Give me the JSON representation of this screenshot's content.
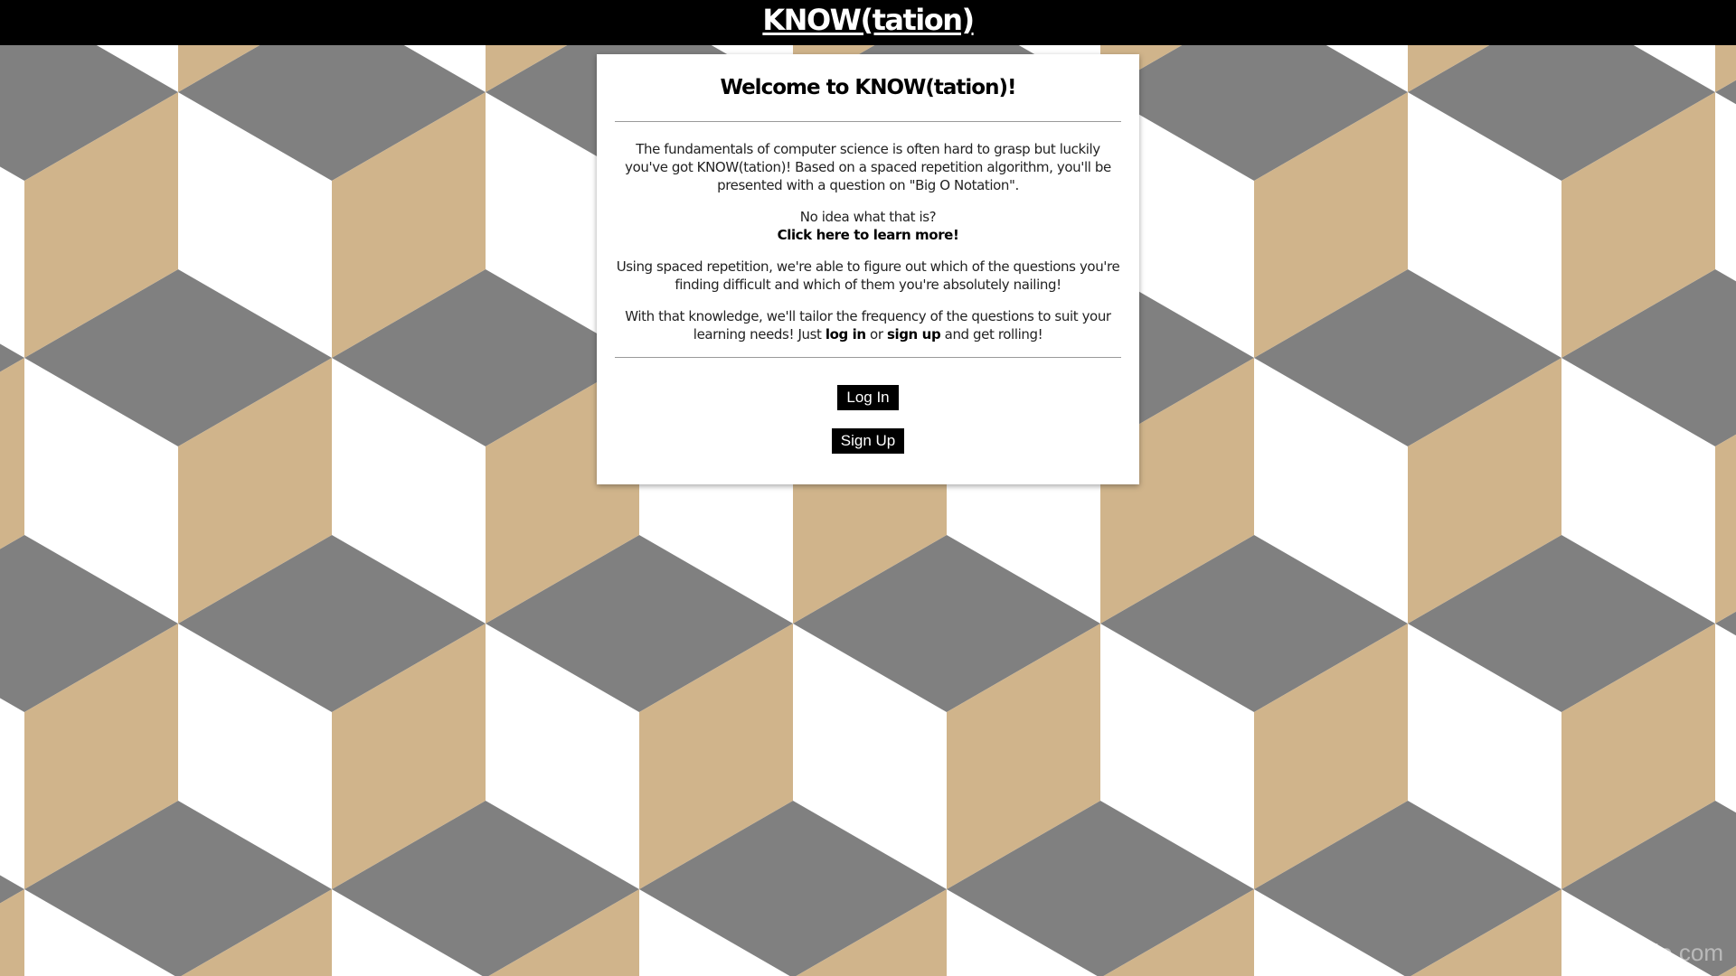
{
  "header": {
    "title": "KNOW(tation)"
  },
  "card": {
    "title": "Welcome to KNOW(tation)!",
    "paragraph1": "The fundamentals of computer science is often hard to grasp but luckily you've got KNOW(tation)! Based on a spaced repetition algorithm, you'll be presented with a question on \"Big O Notation\".",
    "paragraph2_line1": "No idea what that is?",
    "paragraph2_link": "Click here to learn more!",
    "paragraph3": "Using spaced repetition, we're able to figure out which of the questions you're finding difficult and which of them you're absolutely nailing!",
    "paragraph4_pre": "With that knowledge, we'll tailor the frequency of the questions to suit your learning needs! Just ",
    "paragraph4_login": "log in",
    "paragraph4_or": " or ",
    "paragraph4_signup": "sign up",
    "paragraph4_post": " and get rolling!",
    "login_button": "Log In",
    "signup_button": "Sign Up"
  },
  "watermark": "© xmple.com",
  "colors": {
    "header_bg": "#000000",
    "tan": "#D0B48B",
    "gray": "#808080",
    "white": "#FFFFFF",
    "button_bg": "#000000"
  }
}
